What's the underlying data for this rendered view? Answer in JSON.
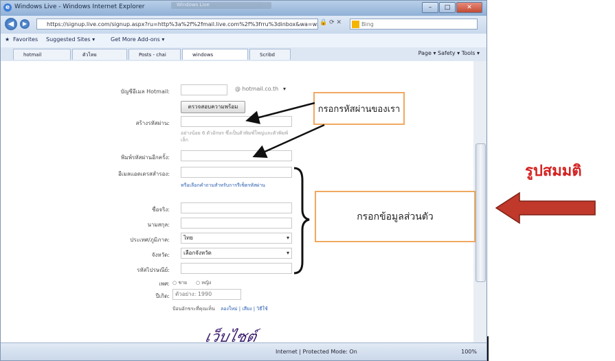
{
  "window": {
    "title": "Windows Live - Windows Internet Explorer",
    "tab_strip_text": "Windows Live",
    "controls": {
      "minimize": "–",
      "maximize": "□",
      "close": "✕"
    }
  },
  "address": {
    "url": "https://signup.live.com/signup.aspx?ru=http%3a%2f%2fmail.live.com%2f%3frru%3dinbox&wa=wsignin",
    "search_placeholder": "Bing"
  },
  "favorites": {
    "label": "Favorites",
    "items": [
      "Suggested Sites ▾",
      "Get More Add-ons ▾"
    ]
  },
  "tabs": [
    "hotmail",
    "ตัวไทย",
    "Posts - chai",
    "windows",
    "Scribd"
  ],
  "commandbar": "Page ▾  Safety ▾  Tools ▾",
  "form": {
    "email_label": "บัญชีอีเมล Hotmail:",
    "domain_value": "@ hotmail.co.th",
    "check_button": "ตรวจสอบความพร้อม",
    "password_label": "สร้างรหัสผ่าน:",
    "password_hint": "อย่างน้อย 6 ตัวอักษร ซึ่งเป็นตัวพิมพ์ใหญ่และตัวพิมพ์เล็ก",
    "confirm_label": "พิมพ์รหัสผ่านอีกครั้ง:",
    "alt_email_label": "อีเมลแอดเดรสสำรอง:",
    "alt_link": "หรือเลือกคำถามสำหรับการรีเซ็ตรหัสผ่าน",
    "firstname_label": "ชื่อจริง:",
    "lastname_label": "นามสกุล:",
    "country_label": "ประเทศ/ภูมิภาค:",
    "country_value": "ไทย",
    "province_label": "จังหวัด:",
    "province_value": "เลือกจังหวัด",
    "zip_label": "รหัสไปรษณีย์:",
    "gender_label": "เพศ:",
    "gender_male": "ชาย",
    "gender_female": "หญิง",
    "birth_label": "ปีเกิด:",
    "birth_placeholder": "ตัวอย่าง: 1990",
    "captcha_note": "ป้อนอักขระที่คุณเห็น",
    "captcha_links": "ลองใหม่ | เสียง | วิธีใช้",
    "captcha_text": "เว็บไซต์"
  },
  "status": {
    "zone": "Internet | Protected Mode: On",
    "zoom": "100%"
  },
  "annotations": {
    "password_callout": "กรอกรหัสผ่านของเรา",
    "personal_callout": "กรอกข้อมูลส่วนตัว",
    "side_title": "รูปสมมติ"
  },
  "colors": {
    "callout_border": "#f0a860",
    "arrow_fill": "#c0392b",
    "side_title": "#d42020"
  }
}
